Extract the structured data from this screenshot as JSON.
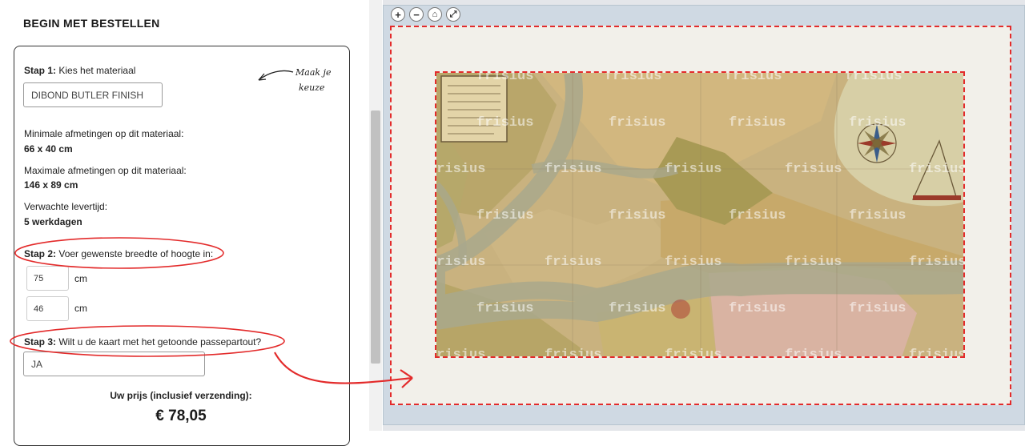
{
  "order": {
    "heading": "BEGIN MET BESTELLEN",
    "step1": {
      "label": "Stap 1:",
      "text": "Kies het materiaal",
      "material": "DIBOND BUTLER FINISH"
    },
    "handwritten_note": [
      "Maak je",
      "keuze"
    ],
    "min_dims": {
      "label": "Minimale afmetingen op dit materiaal:",
      "value": "66 x 40 cm"
    },
    "max_dims": {
      "label": "Maximale afmetingen op dit materiaal:",
      "value": "146 x 89 cm"
    },
    "delivery": {
      "label": "Verwachte levertijd:",
      "value": "5 werkdagen"
    },
    "step2": {
      "label": "Stap 2:",
      "text": "Voer gewenste breedte of hoogte in:",
      "width": "75",
      "height": "46",
      "unit": "cm"
    },
    "step3": {
      "label": "Stap 3:",
      "text": "Wilt u de kaart met het getoonde passepartout?",
      "answer": "JA"
    },
    "price": {
      "label": "Uw prijs (inclusief verzending):",
      "value": "€ 78,05"
    }
  },
  "viewer": {
    "toolbar": [
      {
        "icon": "zoom-in-icon",
        "glyph": "+"
      },
      {
        "icon": "zoom-out-icon",
        "glyph": "−"
      },
      {
        "icon": "home-icon",
        "glyph": "⌂"
      },
      {
        "icon": "fullscreen-icon",
        "glyph": "⤢"
      }
    ],
    "watermark": "frisius"
  },
  "colors": {
    "annotation_red": "#e32b2b",
    "passepartout": "#f2f0ea"
  }
}
